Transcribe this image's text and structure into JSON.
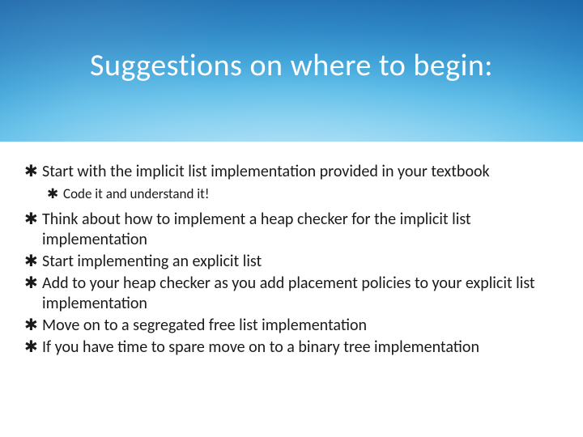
{
  "title": "Suggestions on where to begin:",
  "bullets": {
    "b1": "Start with the implicit list implementation provided in your textbook",
    "b1a": "Code it and understand it!",
    "b2": "Think about how to implement a heap checker for the implicit list implementation",
    "b3": "Start implementing an explicit list",
    "b4": "Add to your heap checker as you add placement policies to your explicit list implementation",
    "b5": "Move on to a segregated free list implementation",
    "b6": "If you have time to spare move on to a binary tree implementation"
  },
  "glyphs": {
    "star": "✱"
  }
}
